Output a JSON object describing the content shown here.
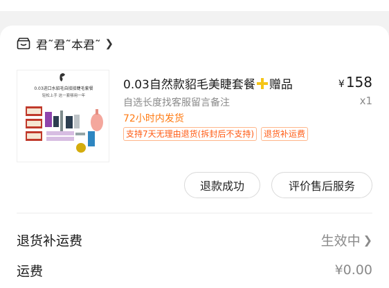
{
  "shop": {
    "name": "君˜君˜本君˜",
    "icon": "shop-icon"
  },
  "product": {
    "title": "0.03自然款貂毛美睫套餐",
    "gift_label": "赠品",
    "spec": "自选长度找客服留言备注",
    "ship_note": "72小时内发货",
    "tags": [
      "支持7天无理由退货(拆封后不支持)",
      "退货补运费"
    ],
    "price_symbol": "¥",
    "price": "158",
    "quantity": "x1",
    "thumb_text_line1": "0.03进口水貂毛自接接睫毛套餐",
    "thumb_text_line2": "轻松上手 这一套够用一年"
  },
  "actions": {
    "refund_label": "退款成功",
    "review_label": "评价售后服务"
  },
  "fees": [
    {
      "label": "退货补运费",
      "value": "生效中"
    },
    {
      "label": "运费",
      "value": "¥0.00"
    }
  ],
  "colors": {
    "accent": "#ff7a12",
    "tag_text": "#ff5a13",
    "gift_plus": "#f5c518"
  }
}
